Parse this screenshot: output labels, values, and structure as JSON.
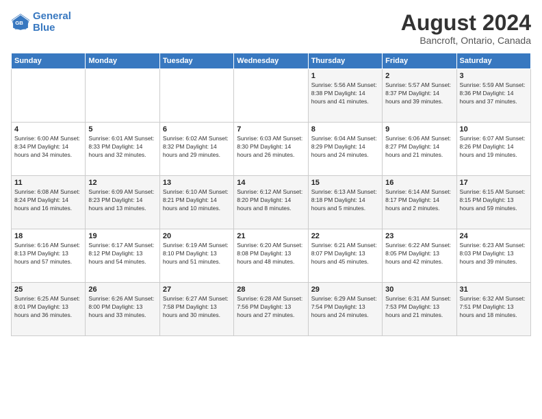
{
  "header": {
    "logo_line1": "General",
    "logo_line2": "Blue",
    "title": "August 2024",
    "subtitle": "Bancroft, Ontario, Canada"
  },
  "calendar": {
    "days_of_week": [
      "Sunday",
      "Monday",
      "Tuesday",
      "Wednesday",
      "Thursday",
      "Friday",
      "Saturday"
    ],
    "weeks": [
      [
        {
          "day": "",
          "info": ""
        },
        {
          "day": "",
          "info": ""
        },
        {
          "day": "",
          "info": ""
        },
        {
          "day": "",
          "info": ""
        },
        {
          "day": "1",
          "info": "Sunrise: 5:56 AM\nSunset: 8:38 PM\nDaylight: 14 hours and 41 minutes."
        },
        {
          "day": "2",
          "info": "Sunrise: 5:57 AM\nSunset: 8:37 PM\nDaylight: 14 hours and 39 minutes."
        },
        {
          "day": "3",
          "info": "Sunrise: 5:59 AM\nSunset: 8:36 PM\nDaylight: 14 hours and 37 minutes."
        }
      ],
      [
        {
          "day": "4",
          "info": "Sunrise: 6:00 AM\nSunset: 8:34 PM\nDaylight: 14 hours and 34 minutes."
        },
        {
          "day": "5",
          "info": "Sunrise: 6:01 AM\nSunset: 8:33 PM\nDaylight: 14 hours and 32 minutes."
        },
        {
          "day": "6",
          "info": "Sunrise: 6:02 AM\nSunset: 8:32 PM\nDaylight: 14 hours and 29 minutes."
        },
        {
          "day": "7",
          "info": "Sunrise: 6:03 AM\nSunset: 8:30 PM\nDaylight: 14 hours and 26 minutes."
        },
        {
          "day": "8",
          "info": "Sunrise: 6:04 AM\nSunset: 8:29 PM\nDaylight: 14 hours and 24 minutes."
        },
        {
          "day": "9",
          "info": "Sunrise: 6:06 AM\nSunset: 8:27 PM\nDaylight: 14 hours and 21 minutes."
        },
        {
          "day": "10",
          "info": "Sunrise: 6:07 AM\nSunset: 8:26 PM\nDaylight: 14 hours and 19 minutes."
        }
      ],
      [
        {
          "day": "11",
          "info": "Sunrise: 6:08 AM\nSunset: 8:24 PM\nDaylight: 14 hours and 16 minutes."
        },
        {
          "day": "12",
          "info": "Sunrise: 6:09 AM\nSunset: 8:23 PM\nDaylight: 14 hours and 13 minutes."
        },
        {
          "day": "13",
          "info": "Sunrise: 6:10 AM\nSunset: 8:21 PM\nDaylight: 14 hours and 10 minutes."
        },
        {
          "day": "14",
          "info": "Sunrise: 6:12 AM\nSunset: 8:20 PM\nDaylight: 14 hours and 8 minutes."
        },
        {
          "day": "15",
          "info": "Sunrise: 6:13 AM\nSunset: 8:18 PM\nDaylight: 14 hours and 5 minutes."
        },
        {
          "day": "16",
          "info": "Sunrise: 6:14 AM\nSunset: 8:17 PM\nDaylight: 14 hours and 2 minutes."
        },
        {
          "day": "17",
          "info": "Sunrise: 6:15 AM\nSunset: 8:15 PM\nDaylight: 13 hours and 59 minutes."
        }
      ],
      [
        {
          "day": "18",
          "info": "Sunrise: 6:16 AM\nSunset: 8:13 PM\nDaylight: 13 hours and 57 minutes."
        },
        {
          "day": "19",
          "info": "Sunrise: 6:17 AM\nSunset: 8:12 PM\nDaylight: 13 hours and 54 minutes."
        },
        {
          "day": "20",
          "info": "Sunrise: 6:19 AM\nSunset: 8:10 PM\nDaylight: 13 hours and 51 minutes."
        },
        {
          "day": "21",
          "info": "Sunrise: 6:20 AM\nSunset: 8:08 PM\nDaylight: 13 hours and 48 minutes."
        },
        {
          "day": "22",
          "info": "Sunrise: 6:21 AM\nSunset: 8:07 PM\nDaylight: 13 hours and 45 minutes."
        },
        {
          "day": "23",
          "info": "Sunrise: 6:22 AM\nSunset: 8:05 PM\nDaylight: 13 hours and 42 minutes."
        },
        {
          "day": "24",
          "info": "Sunrise: 6:23 AM\nSunset: 8:03 PM\nDaylight: 13 hours and 39 minutes."
        }
      ],
      [
        {
          "day": "25",
          "info": "Sunrise: 6:25 AM\nSunset: 8:01 PM\nDaylight: 13 hours and 36 minutes."
        },
        {
          "day": "26",
          "info": "Sunrise: 6:26 AM\nSunset: 8:00 PM\nDaylight: 13 hours and 33 minutes."
        },
        {
          "day": "27",
          "info": "Sunrise: 6:27 AM\nSunset: 7:58 PM\nDaylight: 13 hours and 30 minutes."
        },
        {
          "day": "28",
          "info": "Sunrise: 6:28 AM\nSunset: 7:56 PM\nDaylight: 13 hours and 27 minutes."
        },
        {
          "day": "29",
          "info": "Sunrise: 6:29 AM\nSunset: 7:54 PM\nDaylight: 13 hours and 24 minutes."
        },
        {
          "day": "30",
          "info": "Sunrise: 6:31 AM\nSunset: 7:53 PM\nDaylight: 13 hours and 21 minutes."
        },
        {
          "day": "31",
          "info": "Sunrise: 6:32 AM\nSunset: 7:51 PM\nDaylight: 13 hours and 18 minutes."
        }
      ]
    ]
  },
  "colors": {
    "header_bg": "#3878c0",
    "header_text": "#ffffff",
    "odd_row_bg": "#f5f5f5",
    "even_row_bg": "#ffffff"
  }
}
